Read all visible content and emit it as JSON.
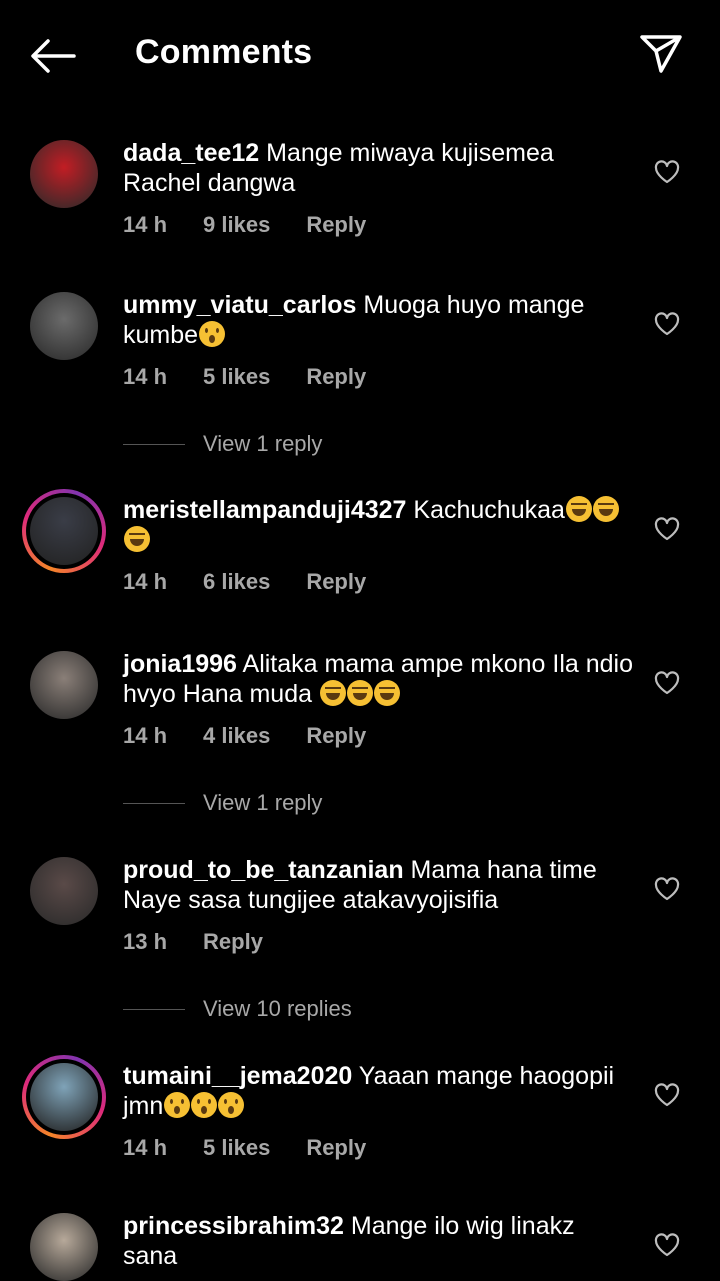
{
  "header": {
    "title": "Comments"
  },
  "comments": [
    {
      "username": "dada_tee12",
      "text": " Mange miwaya kujisemea Rachel dangwa",
      "emojis": [],
      "time": "14 h",
      "likes": "9 likes",
      "reply": "Reply",
      "view_replies": null,
      "story_ring": false,
      "avatar_color": "#c21d24"
    },
    {
      "username": "ummy_viatu_carlos",
      "text": " Muoga huyo mange kumbe",
      "emojis": [
        "wow"
      ],
      "time": "14 h",
      "likes": "5 likes",
      "reply": "Reply",
      "view_replies": "View 1 reply",
      "story_ring": false,
      "avatar_color": "#6b6b6b"
    },
    {
      "username": "meristellampanduji4327",
      "text": " Kachuchukaa",
      "emojis": [
        "laugh",
        "laugh",
        "laugh"
      ],
      "time": "14 h",
      "likes": "6 likes",
      "reply": "Reply",
      "view_replies": null,
      "story_ring": true,
      "avatar_color": "#3a3d47"
    },
    {
      "username": "jonia1996",
      "text": " Alitaka mama ampe mkono Ila ndio hvyo Hana muda ",
      "emojis": [
        "laugh",
        "laugh",
        "laugh"
      ],
      "time": "14 h",
      "likes": "4 likes",
      "reply": "Reply",
      "view_replies": "View 1 reply",
      "story_ring": false,
      "avatar_color": "#8a7f78"
    },
    {
      "username": "proud_to_be_tanzanian",
      "text": " Mama hana time Naye sasa tungijee atakavyojisifia",
      "emojis": [],
      "time": "13 h",
      "likes": "",
      "reply": "Reply",
      "view_replies": "View 10 replies",
      "story_ring": false,
      "avatar_color": "#5a4a48"
    },
    {
      "username": "tumaini__jema2020",
      "text": " Yaaan mange haogopii jmn",
      "emojis": [
        "wow",
        "wow",
        "wow"
      ],
      "time": "14 h",
      "likes": "5 likes",
      "reply": "Reply",
      "view_replies": null,
      "story_ring": true,
      "avatar_color": "#7fa3b8"
    },
    {
      "username": "princessibrahim32",
      "text": " Mange ilo wig linakz sana",
      "emojis": [],
      "time": "",
      "likes": "",
      "reply": "",
      "view_replies": null,
      "story_ring": false,
      "avatar_color": "#b7a99a"
    }
  ],
  "icons": {
    "back": "arrow-left-icon",
    "send": "paper-plane-icon",
    "like": "heart-outline-icon"
  }
}
